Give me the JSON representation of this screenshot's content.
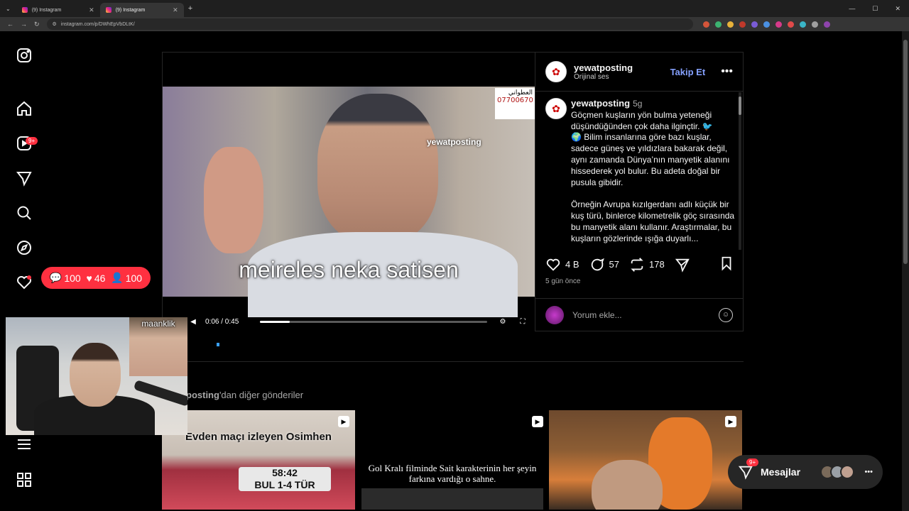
{
  "browser": {
    "tabs": [
      {
        "title": "(9) Instagram",
        "active": false
      },
      {
        "title": "(9) Instagram",
        "active": true
      }
    ],
    "url": "instagram.com/p/DWhEpVbDLtK/"
  },
  "nav": {
    "notifications_badge": "9+",
    "notif_pill": {
      "comments": "100",
      "likes": "46",
      "follows": "100"
    }
  },
  "post": {
    "username": "yewatposting",
    "audio": "Orijinal ses",
    "follow_label": "Takip Et",
    "video": {
      "watermark": "yewatposting",
      "subtitle": "meireles neka satisen",
      "time": "0:06 / 0:45",
      "progress": 0.13,
      "arabic_line1": "العطواني",
      "arabic_phone": "07700670"
    },
    "caption": {
      "username": "yewatposting",
      "age": "5g",
      "paragraph1": "Göçmen kuşların yön bulma yeteneği düşündüğünden çok daha ilginçtir. 🐦",
      "paragraph2": "🌍 Bilim insanlarına göre bazı kuşlar, sadece güneş ve yıldızlara bakarak değil, aynı zamanda Dünya’nın manyetik alanını hissederek yol bulur. Bu adeta doğal bir pusula gibidir.",
      "paragraph3": "Örneğin Avrupa kızılgerdanı adlı küçük bir kuş türü, binlerce kilometrelik göç sırasında bu manyetik alanı kullanır. Araştırmalar, bu kuşların gözlerinde ışığa duyarlı..."
    },
    "likes": "4 B",
    "comments": "57",
    "reposts": "178",
    "posted_ago": "5 gün önce",
    "comment_placeholder": "Yorum ekle..."
  },
  "more_posts": {
    "title_user": "posting",
    "title_suffix": "'dan diğer gönderiler",
    "items": [
      {
        "caption": "Evden maçı izleyen Osimhen",
        "score_time": "58:42",
        "score": "BUL 1-4 TÜR"
      },
      {
        "caption": "Gol Kralı filminde Sait karakterinin her şeyin farkına vardığı o sahne."
      },
      {
        "caption": ""
      }
    ]
  },
  "webcam": {
    "label": "maanklik"
  },
  "messages": {
    "label": "Mesajlar",
    "badge": "9+"
  }
}
